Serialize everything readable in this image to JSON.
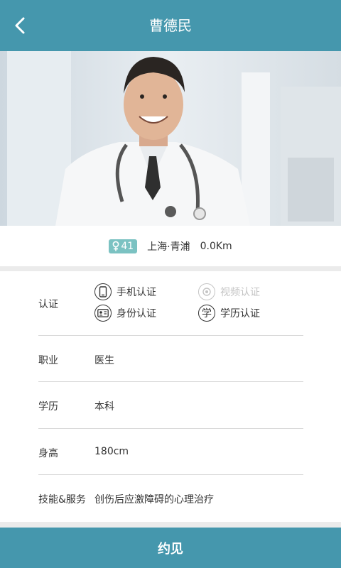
{
  "header": {
    "title": "曹德民"
  },
  "profile": {
    "age": "41",
    "location": "上海·青浦",
    "distance": "0.0Km"
  },
  "details": {
    "cert_label": "认证",
    "certs": [
      {
        "label": "手机认证",
        "icon": "phone-icon",
        "active": true
      },
      {
        "label": "视频认证",
        "icon": "video-icon",
        "active": false
      },
      {
        "label": "身份认证",
        "icon": "id-card-icon",
        "active": true
      },
      {
        "label": "学历认证",
        "icon": "education-icon",
        "active": true
      }
    ],
    "job_label": "职业",
    "job": "医生",
    "edu_label": "学历",
    "edu": "本科",
    "height_label": "身高",
    "height": "180cm",
    "skill_label": "技能&服务",
    "skill": "创伤后应激障碍的心理治疗"
  },
  "action": {
    "label": "约见"
  },
  "colors": {
    "primary": "#4597ad",
    "badge": "#7bc2c2"
  }
}
